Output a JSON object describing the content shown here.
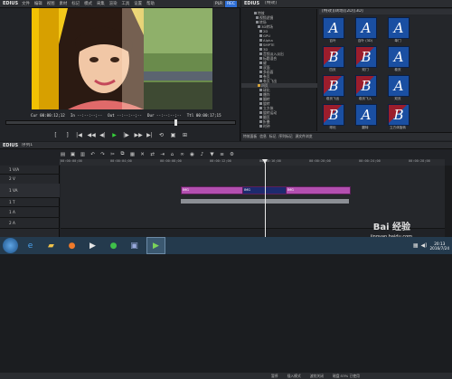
{
  "player": {
    "app_name": "EDIUS",
    "menu": [
      "文件",
      "编辑",
      "视图",
      "素材",
      "标记",
      "模式",
      "采集",
      "渲染",
      "工具",
      "设置",
      "帮助"
    ],
    "mode_plr": "PLR",
    "mode_rec": "REC",
    "timecodes": [
      "Cur 00:00:12;12",
      "In --:--:--;--",
      "Out --:--:--;--",
      "Dur --:--:--;--",
      "Ttl 00:00:17;15"
    ],
    "controls": [
      "[",
      "]",
      "|◀",
      "◀◀",
      "◀|",
      "▶",
      "|▶",
      "▶▶",
      "▶|",
      "⟲",
      "▣",
      "⊞"
    ]
  },
  "bin": {
    "app_name": "EDIUS",
    "tab_label": "[特效]",
    "folder_path": "[特效][转场][2D][3D]",
    "tree": [
      "特效",
      "视频滤镜",
      "转场",
      "3D转场",
      "2D",
      "GPU",
      "Alpha",
      "SMPTE",
      "3D",
      "音频淡入淡出",
      "标题混合",
      "键",
      "双面",
      "多画面",
      "卷页",
      "卷页飞出",
      "四页",
      "球化",
      "爆炸",
      "翻转",
      "旋转",
      "立方体",
      "旋转运动",
      "翻页",
      "折叠",
      "时钟",
      "其他",
      "色彩校正",
      "视频滤镜",
      "音频滤镜",
      "标题混合",
      "键"
    ],
    "effects": [
      {
        "glyph": "A",
        "label": "百叶",
        "style": "blue"
      },
      {
        "glyph": "A",
        "label": "百叶 (3D)",
        "style": "blue"
      },
      {
        "glyph": "A",
        "label": "单门",
        "style": "blue"
      },
      {
        "glyph": "B",
        "label": "四页",
        "style": "red"
      },
      {
        "glyph": "B",
        "label": "双门",
        "style": "red"
      },
      {
        "glyph": "A",
        "label": "卷页",
        "style": "blue"
      },
      {
        "glyph": "B",
        "label": "卷页飞出",
        "style": "red"
      },
      {
        "glyph": "B",
        "label": "卷页飞入",
        "style": "red"
      },
      {
        "glyph": "A",
        "label": "双页",
        "style": "blue"
      },
      {
        "glyph": "B",
        "label": "球化",
        "style": "red"
      },
      {
        "glyph": "A",
        "label": "翻转",
        "style": "blue"
      },
      {
        "glyph": "B",
        "label": "立方体旋转",
        "style": "red"
      }
    ],
    "bottom_tabs": [
      "特效面板",
      "信息",
      "标记",
      "序列标记",
      "源文件浏览"
    ]
  },
  "timeline": {
    "app_name": "EDIUS",
    "sequence_name": "序列1",
    "sequence_tab": "序列1",
    "ruler_ticks": [
      "00:00:00;00",
      "00:00:04;00",
      "00:00:08;00",
      "00:00:12;00",
      "00:00:16;00",
      "00:00:20;00",
      "00:00:24;00",
      "00:00:28;00"
    ],
    "tracks": [
      "1 V/A",
      "2 V",
      "1 VA",
      "1 T",
      "1 A",
      "2 A"
    ],
    "clips": [
      {
        "track": 2,
        "label": "IMG"
      },
      {
        "track": 2,
        "label": "IMG"
      },
      {
        "track": 2,
        "label": "IMG"
      }
    ],
    "status": [
      "暂停",
      "插入模式",
      "波纹关闭",
      "磁盘:53% 已使用"
    ]
  },
  "taskbar": {
    "apps": [
      "IE",
      "文件夹",
      "Firefox",
      "媒体",
      "360",
      "图片",
      "EDIUS"
    ],
    "time": "20:13",
    "date": "2016/7/24"
  },
  "watermark": {
    "text": "Bai 经验",
    "url": "jingyan.baidu.com"
  }
}
